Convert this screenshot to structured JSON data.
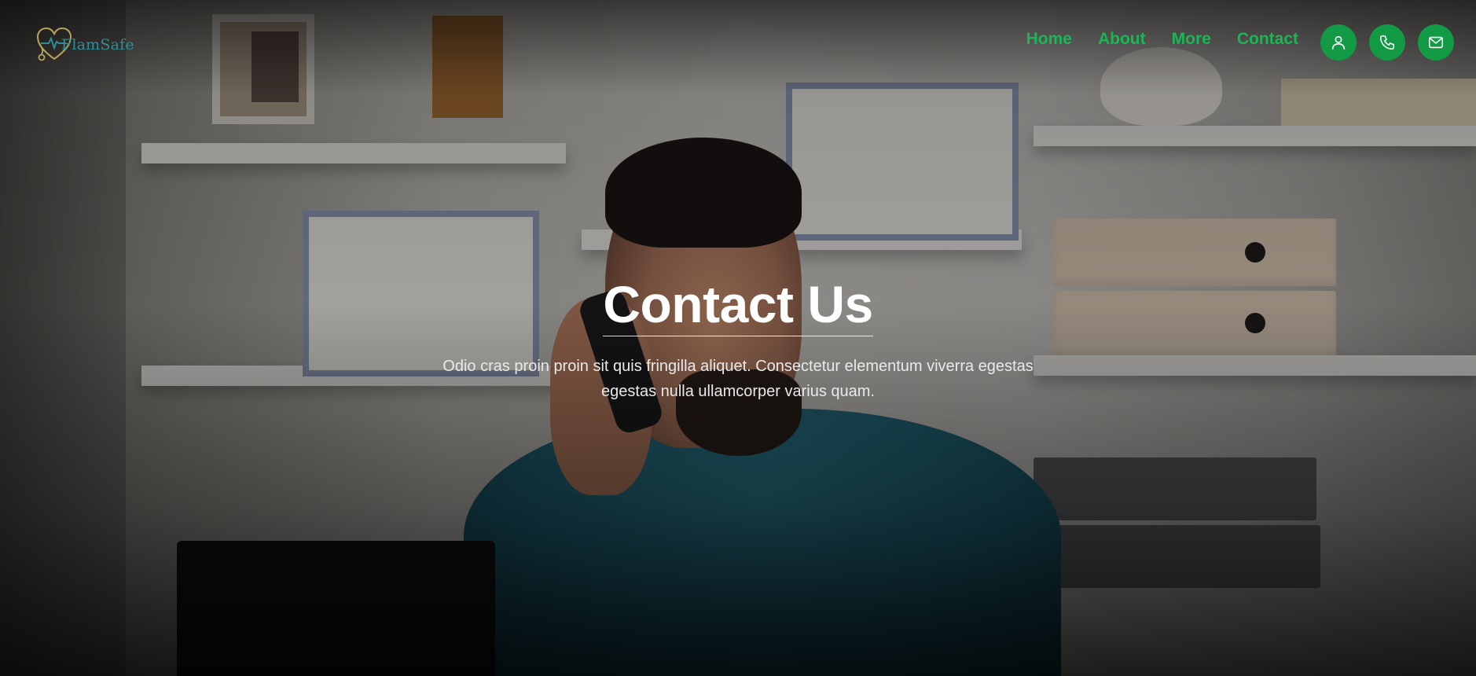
{
  "header": {
    "logo_text": "FlamSafe",
    "nav": [
      {
        "label": "Home"
      },
      {
        "label": "About"
      },
      {
        "label": "More"
      },
      {
        "label": "Contact"
      }
    ],
    "icons": [
      "user-icon",
      "phone-icon",
      "mail-icon"
    ]
  },
  "hero": {
    "title": "Contact Us",
    "subtitle": "Odio cras proin proin sit quis fringilla aliquet. Consectetur elementum viverra egestas egestas nulla ullamcorper varius quam."
  },
  "colors": {
    "nav_link": "#1cb556",
    "icon_button": "#129a45",
    "logo": "#2f8f97",
    "title": "#ffffff"
  }
}
